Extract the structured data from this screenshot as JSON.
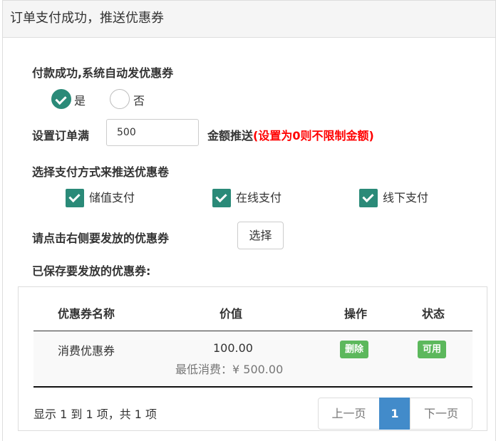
{
  "header": {
    "title": "订单支付成功，推送优惠券"
  },
  "auto_coupon": {
    "label": "付款成功,系统自动发优惠券",
    "options": [
      {
        "label": "是",
        "checked": true
      },
      {
        "label": "否",
        "checked": false
      }
    ]
  },
  "threshold": {
    "prefix": "设置订单满",
    "value": "500",
    "suffix": "金额推送",
    "note": "(设置为0则不限制金额)"
  },
  "payment_methods": {
    "label": "选择支付方式来推送优惠卷",
    "items": [
      {
        "label": "储值支付",
        "checked": true
      },
      {
        "label": "在线支付",
        "checked": true
      },
      {
        "label": "线下支付",
        "checked": true
      }
    ]
  },
  "select_coupon": {
    "label": "请点击右侧要发放的优惠券",
    "button": "选择"
  },
  "saved": {
    "label": "已保存要发放的优惠券:",
    "columns": [
      "优惠券名称",
      "价值",
      "操作",
      "状态"
    ],
    "rows": [
      {
        "name": "消费优惠券",
        "value": "100.00",
        "min_spend": "最低消费：¥ 500.00",
        "action": "删除",
        "status": "可用"
      }
    ],
    "footer": "显示 1 到 1 项，共 1 项",
    "pagination": {
      "prev": "上一页",
      "current": "1",
      "next": "下一页"
    }
  },
  "colors": {
    "check_green": "#2a8a78",
    "badge_green": "#5cb85c",
    "pager_active": "#428bca",
    "note_red": "#ff0000"
  }
}
